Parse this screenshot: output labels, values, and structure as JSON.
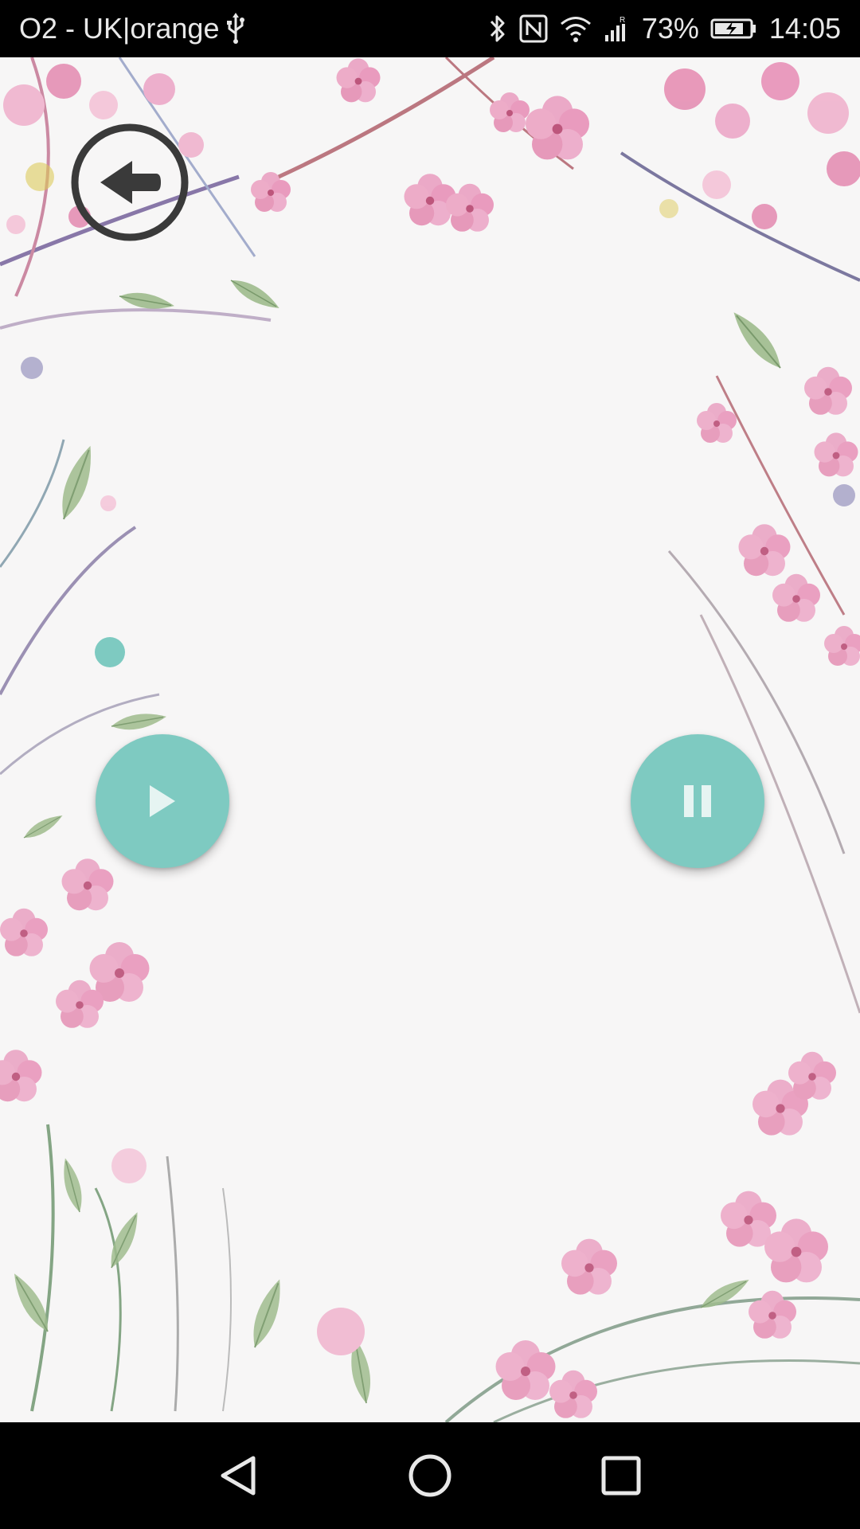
{
  "status_bar": {
    "carrier": "O2 - UK|orange",
    "usb_icon": "usb-icon",
    "battery_percent": "73%",
    "time": "14:05",
    "icons": [
      "bluetooth-icon",
      "nfc-icon",
      "wifi-icon",
      "signal-icon",
      "battery-charging-icon"
    ]
  },
  "player": {
    "back_icon": "back-arrow-circle-icon",
    "play_icon": "play-icon",
    "pause_icon": "pause-icon",
    "accent_color": "#7ecac1",
    "progress": 0
  },
  "nav_bar": {
    "icons": [
      "nav-back-icon",
      "nav-home-icon",
      "nav-recents-icon"
    ]
  },
  "colors": {
    "background": "#f7f6f6",
    "accent": "#7ecac1",
    "blossom_pink": "#e58fb4",
    "leaf_green": "#8fb27a"
  }
}
